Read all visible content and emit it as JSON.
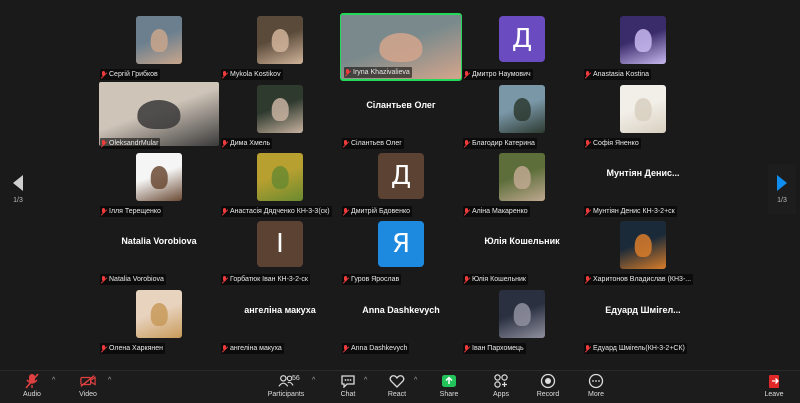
{
  "participants": [
    {
      "name": "Сергій Грибков",
      "display": "photo",
      "colors": [
        "#6b7f8f",
        "#c9a68c"
      ]
    },
    {
      "name": "Mykola Kostikov",
      "display": "photo",
      "colors": [
        "#5a4a3a",
        "#d1b49a"
      ]
    },
    {
      "name": "Iryna Khazivalieva",
      "display": "photo",
      "active": true,
      "colors": [
        "#7a8a8c",
        "#d4a58c"
      ]
    },
    {
      "name": "Дмитро Наумович",
      "display": "letter",
      "letter": "Д",
      "bg": "#6a4cc0"
    },
    {
      "name": "Anastasia Kostina",
      "display": "photo",
      "colors": [
        "#3a2b6a",
        "#c9b9f0"
      ]
    },
    {
      "name": "OleksandrMular",
      "display": "photo",
      "wide": true,
      "colors": [
        "#cfc4b8",
        "#3a3a3a"
      ]
    },
    {
      "name": "Дима Хмель",
      "display": "photo",
      "colors": [
        "#2e3a2e",
        "#c8b2a0"
      ]
    },
    {
      "name": "Сілантьев Олег",
      "display": "text",
      "title": "Сілантьев Олег"
    },
    {
      "name": "Благодир Катерина",
      "display": "photo",
      "colors": [
        "#7a97a8",
        "#2d3a30"
      ]
    },
    {
      "name": "Софія Яненко",
      "display": "photo",
      "colors": [
        "#f2efe8",
        "#d8cfc0"
      ]
    },
    {
      "name": "Ілля Терещенко",
      "display": "photo",
      "colors": [
        "#f5f5f5",
        "#6b4a34"
      ]
    },
    {
      "name": "Анастасія Дядченко КН-3-3(ск)",
      "display": "photo",
      "colors": [
        "#b8a030",
        "#6a8a30"
      ]
    },
    {
      "name": "Дмитрій Бдовенко",
      "display": "letter",
      "letter": "Д",
      "bg": "#5b4233"
    },
    {
      "name": "Аліна Макаренко",
      "display": "photo",
      "colors": [
        "#5d6e3a",
        "#bfa890"
      ]
    },
    {
      "name": "Мунтіян Денис КН-3-2+ск",
      "display": "text",
      "title": "Мунтіян Денис..."
    },
    {
      "name": "Natalia Vorobiova",
      "display": "text",
      "title": "Natalia Vorobiova"
    },
    {
      "name": "Горбатюк Іван КН-3-2-ск",
      "display": "letter",
      "letter": "І",
      "bg": "#5b4233"
    },
    {
      "name": "Гуров Ярослав",
      "display": "letter",
      "letter": "Я",
      "bg": "#1d8ae0"
    },
    {
      "name": "Юлія Кошельник",
      "display": "text",
      "title": "Юлія Кошельник"
    },
    {
      "name": "Харитонов Владислав (КН3-...",
      "display": "photo",
      "colors": [
        "#1a2a38",
        "#d97d2a"
      ]
    },
    {
      "name": "Олена Харкянен",
      "display": "photo",
      "colors": [
        "#e8d3bf",
        "#c89a5a"
      ]
    },
    {
      "name": "ангеліна макуха",
      "display": "text",
      "title": "ангеліна макуха"
    },
    {
      "name": "Anna Dashkevych",
      "display": "text",
      "title": "Anna Dashkevych"
    },
    {
      "name": "Іван Пархомець",
      "display": "photo",
      "colors": [
        "#2a3040",
        "#9090a0"
      ]
    },
    {
      "name": "Едуард Шмігель(КН-3-2+СК)",
      "display": "text",
      "title": "Едуард Шмігел..."
    }
  ],
  "pager": {
    "left": "1/3",
    "right": "1/3"
  },
  "toolbar": {
    "audio": "Audio",
    "video": "Video",
    "participants": "Participants",
    "participants_count": "56",
    "chat": "Chat",
    "react": "React",
    "share": "Share",
    "apps": "Apps",
    "record": "Record",
    "more": "More",
    "leave": "Leave"
  },
  "colors": {
    "accent": "#23d959",
    "muted": "#ef3b3b",
    "share": "#22c35a",
    "leave": "#e02828"
  }
}
